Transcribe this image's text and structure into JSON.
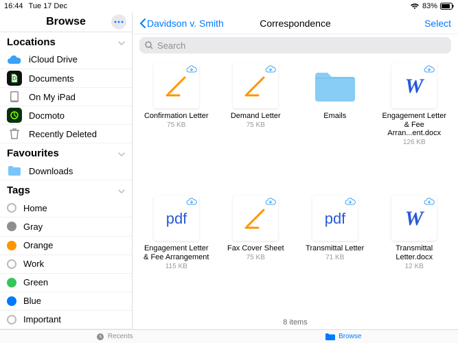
{
  "status": {
    "time": "16:44",
    "date": "Tue 17 Dec",
    "battery": "83%"
  },
  "sidebar": {
    "title": "Browse",
    "sections": {
      "locations": {
        "head": "Locations",
        "items": [
          {
            "label": "iCloud Drive",
            "icon": "icloud",
            "color": "#3ba1f6"
          },
          {
            "label": "Documents",
            "icon": "docmoto-doc",
            "color": "#0a0a0a"
          },
          {
            "label": "On My iPad",
            "icon": "ipad",
            "color": "#8e8e93"
          },
          {
            "label": "Docmoto",
            "icon": "docmoto",
            "color": "#1aa01a"
          },
          {
            "label": "Recently Deleted",
            "icon": "trash",
            "color": "#8e8e93"
          }
        ]
      },
      "favourites": {
        "head": "Favourites",
        "items": [
          {
            "label": "Downloads",
            "icon": "folder",
            "color": "#4bb3f7"
          }
        ]
      },
      "tags": {
        "head": "Tags",
        "items": [
          {
            "label": "Home",
            "color": "none"
          },
          {
            "label": "Gray",
            "color": "#8e8e93"
          },
          {
            "label": "Orange",
            "color": "#ff9500"
          },
          {
            "label": "Work",
            "color": "none"
          },
          {
            "label": "Green",
            "color": "#34c759"
          },
          {
            "label": "Blue",
            "color": "#007aff"
          },
          {
            "label": "Important",
            "color": "none"
          }
        ]
      }
    }
  },
  "main": {
    "back": "Davidson v. Smith",
    "title": "Correspondence",
    "select": "Select",
    "search_placeholder": "Search",
    "item_count": "8 items",
    "items": [
      {
        "name": "Confirmation Letter",
        "meta": "75 KB",
        "type": "pages",
        "cloud": true
      },
      {
        "name": "Demand Letter",
        "meta": "75 KB",
        "type": "pages",
        "cloud": true
      },
      {
        "name": "Emails",
        "meta": "",
        "type": "folder",
        "cloud": false
      },
      {
        "name": "Engagement Letter & Fee Arran...ent.docx",
        "meta": "126 KB",
        "type": "word",
        "cloud": true
      },
      {
        "name": "Engagement Letter & Fee Arrangement",
        "meta": "115 KB",
        "type": "pdf",
        "cloud": true
      },
      {
        "name": "Fax Cover Sheet",
        "meta": "75 KB",
        "type": "pages",
        "cloud": true
      },
      {
        "name": "Transmittal Letter",
        "meta": "71 KB",
        "type": "pdf",
        "cloud": true
      },
      {
        "name": "Transmittal Letter.docx",
        "meta": "12 KB",
        "type": "word",
        "cloud": true
      }
    ]
  },
  "tabbar": {
    "recents": "Recents",
    "browse": "Browse"
  },
  "colors": {
    "accent": "#007aff",
    "orange": "#ff9500"
  }
}
